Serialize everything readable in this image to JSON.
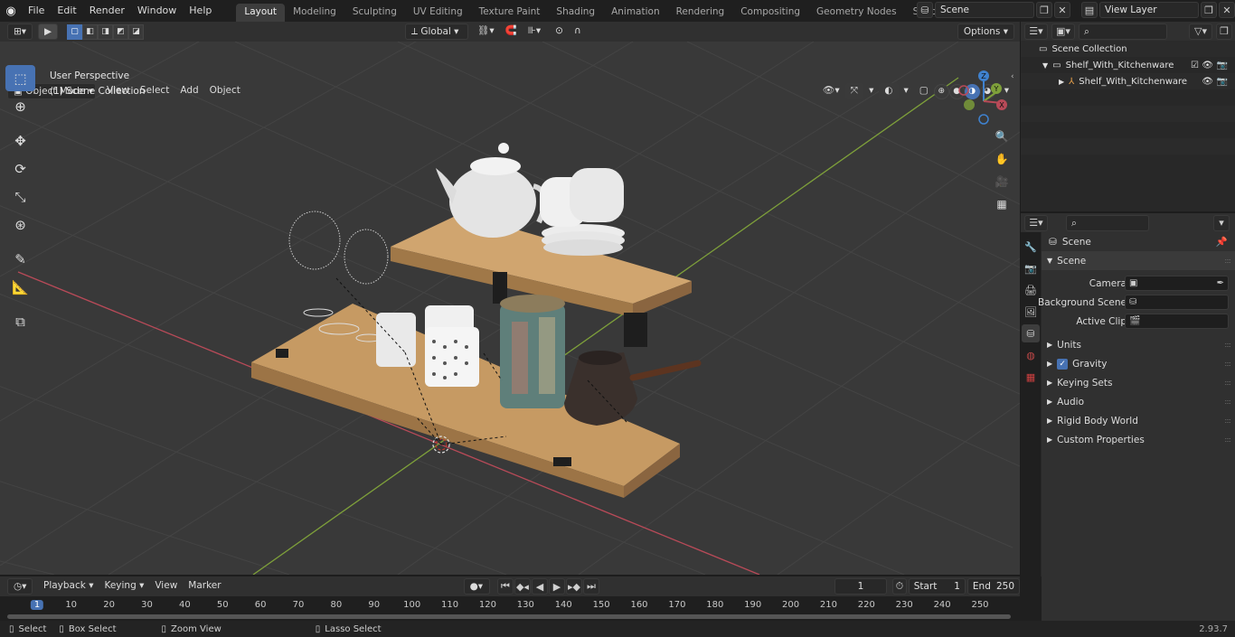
{
  "topbar": {
    "menus": [
      "File",
      "Edit",
      "Render",
      "Window",
      "Help"
    ],
    "workspaces": [
      "Layout",
      "Modeling",
      "Sculpting",
      "UV Editing",
      "Texture Paint",
      "Shading",
      "Animation",
      "Rendering",
      "Compositing",
      "Geometry Nodes",
      "Scripting"
    ],
    "active_workspace": "Layout",
    "scene_name": "Scene",
    "view_layer": "View Layer"
  },
  "viewport_header": {
    "mode": "Object Mode",
    "menus": [
      "View",
      "Select",
      "Add",
      "Object"
    ],
    "transform_orientation": "Global",
    "options_label": "Options"
  },
  "viewport": {
    "perspective_label": "User Perspective",
    "collection_label": "(1) Scene Collection"
  },
  "gizmo": {
    "x": "X",
    "y": "Y",
    "z": "Z"
  },
  "outliner": {
    "root": "Scene Collection",
    "collection": "Shelf_With_Kitchenware",
    "object": "Shelf_With_Kitchenware"
  },
  "properties": {
    "context_name": "Scene",
    "panel_title": "Scene",
    "camera_label": "Camera",
    "background_scene_label": "Background Scene",
    "active_clip_label": "Active Clip",
    "sub_panels": [
      "Units",
      "Gravity",
      "Keying Sets",
      "Audio",
      "Rigid Body World",
      "Custom Properties"
    ]
  },
  "timeline": {
    "menus": [
      "Playback",
      "Keying",
      "View",
      "Marker"
    ],
    "current_frame": "1",
    "start_label": "Start",
    "start_value": "1",
    "end_label": "End",
    "end_value": "250",
    "ruler_ticks": [
      "1",
      "10",
      "20",
      "30",
      "40",
      "50",
      "60",
      "70",
      "80",
      "90",
      "100",
      "110",
      "120",
      "130",
      "140",
      "150",
      "160",
      "170",
      "180",
      "190",
      "200",
      "210",
      "220",
      "230",
      "240",
      "250"
    ]
  },
  "statusbar": {
    "select": "Select",
    "box_select": "Box Select",
    "zoom_view": "Zoom View",
    "lasso_select": "Lasso Select",
    "version": "2.93.7"
  },
  "colors": {
    "accent": "#4772b3",
    "x_axis": "#b84a58",
    "y_axis": "#7ea03a",
    "z_axis": "#3f82cf",
    "wood": "#c69a63"
  }
}
